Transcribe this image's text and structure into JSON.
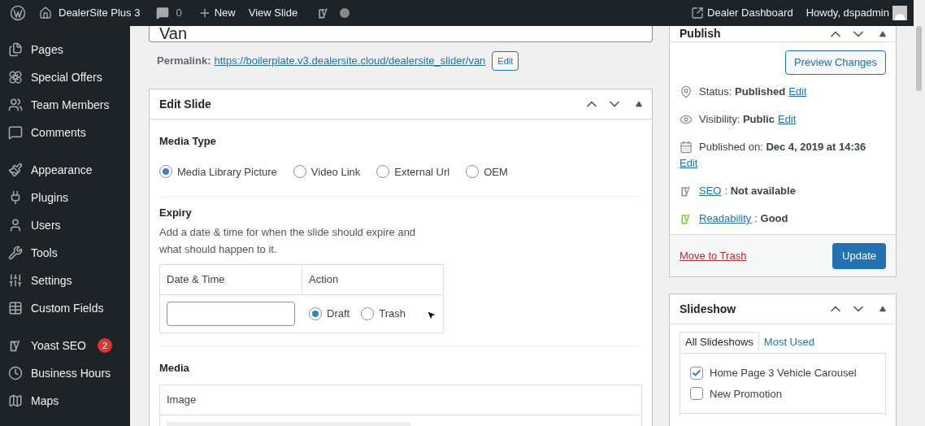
{
  "admin_bar": {
    "site_name": "DealerSite Plus 3",
    "comments_count": "0",
    "new_label": "New",
    "view_label": "View Slide",
    "dealer_dashboard": "Dealer Dashboard",
    "greeting": "Howdy, dspadmin"
  },
  "sidebar": {
    "groups": [
      [
        {
          "label": "Pages"
        },
        {
          "label": "Special Offers"
        },
        {
          "label": "Team Members"
        },
        {
          "label": "Comments"
        }
      ],
      [
        {
          "label": "Appearance"
        },
        {
          "label": "Plugins"
        },
        {
          "label": "Users"
        },
        {
          "label": "Tools"
        },
        {
          "label": "Settings"
        },
        {
          "label": "Custom Fields"
        }
      ],
      [
        {
          "label": "Yoast SEO",
          "badge": "2"
        },
        {
          "label": "Business Hours"
        },
        {
          "label": "Maps"
        }
      ]
    ]
  },
  "title": "Van",
  "permalink": {
    "label": "Permalink:",
    "url": "https://boilerplate.v3.dealersite.cloud/dealersite_slider/van",
    "button": "Edit"
  },
  "edit_slide": {
    "title": "Edit Slide",
    "media_type": {
      "label": "Media Type",
      "options": [
        {
          "label": "Media Library Picture",
          "selected": true
        },
        {
          "label": "Video Link",
          "selected": false
        },
        {
          "label": "External Url",
          "selected": false
        },
        {
          "label": "OEM",
          "selected": false
        }
      ]
    },
    "expiry": {
      "label": "Expiry",
      "description": "Add a date & time for when the slide should expire and what should happen to it.",
      "columns": [
        "Date & Time",
        "Action"
      ],
      "actions": [
        {
          "label": "Draft",
          "selected": true
        },
        {
          "label": "Trash",
          "selected": false
        }
      ]
    },
    "media": {
      "label": "Media",
      "column": "Image"
    }
  },
  "publish": {
    "title": "Publish",
    "preview_button": "Preview Changes",
    "rows": [
      {
        "kind": "status",
        "text": "Status: **Published**",
        "edit": "Edit"
      },
      {
        "kind": "visibility",
        "text": "Visibility: **Public**",
        "edit": "Edit"
      },
      {
        "kind": "date",
        "text": "Published on: **Dec 4, 2019 at 14:36**",
        "edit": "Edit"
      },
      {
        "kind": "seo",
        "link": "SEO",
        "text": ": **Not available**"
      },
      {
        "kind": "readability",
        "link": "Readability",
        "text": ": **Good**"
      }
    ],
    "trash": "Move to Trash",
    "update": "Update"
  },
  "slideshow": {
    "title": "Slideshow",
    "tabs": [
      {
        "label": "All Slideshows",
        "selected": true
      },
      {
        "label": "Most Used",
        "selected": false
      }
    ],
    "items": [
      {
        "label": "Home Page 3 Vehicle Carousel",
        "checked": true
      },
      {
        "label": "New Promotion",
        "checked": false
      }
    ]
  }
}
